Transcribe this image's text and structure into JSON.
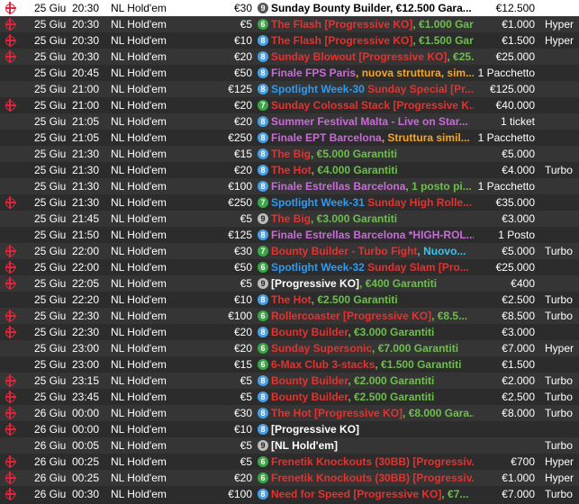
{
  "colors": {
    "red": "#e5322f",
    "green": "#6cc04a",
    "orange": "#f5a623",
    "pink": "#ff5a5a",
    "purple": "#c86bd8",
    "cyan": "#33c6ef",
    "blue": "#2f9bf0",
    "white": "#ffffff",
    "black": "#000000"
  },
  "rows": [
    {
      "icon": "target-icon",
      "date": "25 Giu",
      "time": "20:30",
      "game": "NL Hold'em",
      "buyin": "€30",
      "badge": "9",
      "badge_color": "dark",
      "name": [
        {
          "t": "Sunday Bounty Builder, €12.500 Gara...",
          "c": "black"
        }
      ],
      "prize": "€12.500",
      "speed": "",
      "selected": true
    },
    {
      "icon": "target-icon",
      "date": "25 Giu",
      "time": "20:30",
      "game": "NL Hold'em",
      "buyin": "€5",
      "badge": "6",
      "badge_color": "green",
      "name": [
        {
          "t": "The Flash [Progressive KO]",
          "c": "red"
        },
        {
          "t": ", €1.000 Garanti...",
          "c": "green"
        }
      ],
      "prize": "€1.000",
      "speed": "Hyper"
    },
    {
      "icon": "target-icon",
      "date": "25 Giu",
      "time": "20:30",
      "game": "NL Hold'em",
      "buyin": "€10",
      "badge": "8",
      "badge_color": "blue",
      "name": [
        {
          "t": "The Flash [Progressive KO]",
          "c": "red"
        },
        {
          "t": ", €1.500 Garanti...",
          "c": "green"
        }
      ],
      "prize": "€1.500",
      "speed": "Hyper"
    },
    {
      "icon": "target-icon",
      "date": "25 Giu",
      "time": "20:30",
      "game": "NL Hold'em",
      "buyin": "€20",
      "badge": "8",
      "badge_color": "blue",
      "name": [
        {
          "t": "Sunday Blowout [Progressive KO]",
          "c": "red"
        },
        {
          "t": ", €25.000...",
          "c": "green"
        }
      ],
      "prize": "€25.000",
      "speed": ""
    },
    {
      "icon": "",
      "date": "25 Giu",
      "time": "20:45",
      "game": "NL Hold'em",
      "buyin": "€50",
      "badge": "8",
      "badge_color": "blue",
      "name": [
        {
          "t": "Finale FPS Paris",
          "c": "purple"
        },
        {
          "t": ", nuova struttura, sim...",
          "c": "orange"
        }
      ],
      "prize": "1 Pacchetto",
      "speed": ""
    },
    {
      "icon": "",
      "date": "25 Giu",
      "time": "21:00",
      "game": "NL Hold'em",
      "buyin": "€125",
      "badge": "8",
      "badge_color": "blue",
      "name": [
        {
          "t": "Spotlight Week-30",
          "c": "blue"
        },
        {
          "t": " Sunday Special [Pr...",
          "c": "red"
        }
      ],
      "prize": "€125.000",
      "speed": ""
    },
    {
      "icon": "target-icon",
      "date": "25 Giu",
      "time": "21:00",
      "game": "NL Hold'em",
      "buyin": "€20",
      "badge": "7",
      "badge_color": "green",
      "name": [
        {
          "t": "Sunday Colossal Stack [Progressive K...",
          "c": "red"
        }
      ],
      "prize": "€40.000",
      "speed": ""
    },
    {
      "icon": "",
      "date": "25 Giu",
      "time": "21:05",
      "game": "NL Hold'em",
      "buyin": "€20",
      "badge": "8",
      "badge_color": "blue",
      "name": [
        {
          "t": "Summer Festival Malta - Live on Star...",
          "c": "purple"
        }
      ],
      "prize": "1 ticket",
      "speed": ""
    },
    {
      "icon": "",
      "date": "25 Giu",
      "time": "21:05",
      "game": "NL Hold'em",
      "buyin": "€250",
      "badge": "8",
      "badge_color": "blue",
      "name": [
        {
          "t": "Finale EPT Barcelona",
          "c": "purple"
        },
        {
          "t": ", Struttura simil...",
          "c": "orange"
        }
      ],
      "prize": "1 Pacchetto",
      "speed": ""
    },
    {
      "icon": "",
      "date": "25 Giu",
      "time": "21:30",
      "game": "NL Hold'em",
      "buyin": "€15",
      "badge": "8",
      "badge_color": "blue",
      "name": [
        {
          "t": "The Big",
          "c": "red"
        },
        {
          "t": ", €5.000 Garantiti",
          "c": "green"
        }
      ],
      "prize": "€5.000",
      "speed": ""
    },
    {
      "icon": "",
      "date": "25 Giu",
      "time": "21:30",
      "game": "NL Hold'em",
      "buyin": "€20",
      "badge": "8",
      "badge_color": "blue",
      "name": [
        {
          "t": "The Hot",
          "c": "red"
        },
        {
          "t": ", €4.000 Garantiti",
          "c": "green"
        }
      ],
      "prize": "€4.000",
      "speed": "Turbo"
    },
    {
      "icon": "",
      "date": "25 Giu",
      "time": "21:30",
      "game": "NL Hold'em",
      "buyin": "€100",
      "badge": "8",
      "badge_color": "blue",
      "name": [
        {
          "t": "Finale Estrellas Barcelona",
          "c": "purple"
        },
        {
          "t": ", 1 posto pi...",
          "c": "green"
        }
      ],
      "prize": "1 Pacchetto",
      "speed": ""
    },
    {
      "icon": "target-icon",
      "date": "25 Giu",
      "time": "21:30",
      "game": "NL Hold'em",
      "buyin": "€250",
      "badge": "7",
      "badge_color": "green",
      "name": [
        {
          "t": "Spotlight Week-31",
          "c": "blue"
        },
        {
          "t": " Sunday High Rolle...",
          "c": "red"
        }
      ],
      "prize": "€35.000",
      "speed": ""
    },
    {
      "icon": "",
      "date": "25 Giu",
      "time": "21:45",
      "game": "NL Hold'em",
      "buyin": "€5",
      "badge": "9",
      "badge_color": "gray",
      "name": [
        {
          "t": "The Big",
          "c": "red"
        },
        {
          "t": ", €3.000 Garantiti",
          "c": "green"
        }
      ],
      "prize": "€3.000",
      "speed": ""
    },
    {
      "icon": "",
      "date": "25 Giu",
      "time": "21:50",
      "game": "NL Hold'em",
      "buyin": "€125",
      "badge": "8",
      "badge_color": "blue",
      "name": [
        {
          "t": "Finale Estrellas Barcelona *HIGH-ROL...",
          "c": "purple"
        }
      ],
      "prize": "1 Posto",
      "speed": ""
    },
    {
      "icon": "target-icon",
      "date": "25 Giu",
      "time": "22:00",
      "game": "NL Hold'em",
      "buyin": "€30",
      "badge": "7",
      "badge_color": "green",
      "name": [
        {
          "t": "Bounty Builder - Turbo Fight",
          "c": "red"
        },
        {
          "t": ", Nuovo...",
          "c": "cyan"
        }
      ],
      "prize": "€5.000",
      "speed": "Turbo"
    },
    {
      "icon": "target-icon",
      "date": "25 Giu",
      "time": "22:00",
      "game": "NL Hold'em",
      "buyin": "€50",
      "badge": "6",
      "badge_color": "green",
      "name": [
        {
          "t": "Spotlight Week-32",
          "c": "blue"
        },
        {
          "t": " Sunday Slam [Pro...",
          "c": "red"
        }
      ],
      "prize": "€25.000",
      "speed": ""
    },
    {
      "icon": "target-icon",
      "date": "25 Giu",
      "time": "22:05",
      "game": "NL Hold'em",
      "buyin": "€5",
      "badge": "9",
      "badge_color": "gray",
      "name": [
        {
          "t": "[Progressive KO]",
          "c": "white"
        },
        {
          "t": ", €400 Garantiti",
          "c": "green"
        }
      ],
      "prize": "€400",
      "speed": ""
    },
    {
      "icon": "",
      "date": "25 Giu",
      "time": "22:20",
      "game": "NL Hold'em",
      "buyin": "€10",
      "badge": "8",
      "badge_color": "blue",
      "name": [
        {
          "t": "The Hot",
          "c": "red"
        },
        {
          "t": ", €2.500 Garantiti",
          "c": "green"
        }
      ],
      "prize": "€2.500",
      "speed": "Turbo"
    },
    {
      "icon": "target-icon",
      "date": "25 Giu",
      "time": "22:30",
      "game": "NL Hold'em",
      "buyin": "€100",
      "badge": "6",
      "badge_color": "green",
      "name": [
        {
          "t": "Rollercoaster [Progressive KO]",
          "c": "red"
        },
        {
          "t": ", €8.5...",
          "c": "green"
        }
      ],
      "prize": "€8.500",
      "speed": "Turbo"
    },
    {
      "icon": "target-icon",
      "date": "25 Giu",
      "time": "22:30",
      "game": "NL Hold'em",
      "buyin": "€20",
      "badge": "8",
      "badge_color": "blue",
      "name": [
        {
          "t": "Bounty Builder",
          "c": "red"
        },
        {
          "t": ", €3.000 Garantiti",
          "c": "green"
        }
      ],
      "prize": "€3.000",
      "speed": ""
    },
    {
      "icon": "",
      "date": "25 Giu",
      "time": "23:00",
      "game": "NL Hold'em",
      "buyin": "€20",
      "badge": "6",
      "badge_color": "green",
      "name": [
        {
          "t": "Sunday Supersonic",
          "c": "red"
        },
        {
          "t": ", €7.000 Garantiti",
          "c": "green"
        }
      ],
      "prize": "€7.000",
      "speed": "Hyper"
    },
    {
      "icon": "",
      "date": "25 Giu",
      "time": "23:00",
      "game": "NL Hold'em",
      "buyin": "€15",
      "badge": "6",
      "badge_color": "green",
      "name": [
        {
          "t": "6-Max Club 3-stacks",
          "c": "red"
        },
        {
          "t": ", €1.500 Garantiti",
          "c": "green"
        }
      ],
      "prize": "€1.500",
      "speed": ""
    },
    {
      "icon": "target-icon",
      "date": "25 Giu",
      "time": "23:15",
      "game": "NL Hold'em",
      "buyin": "€5",
      "badge": "8",
      "badge_color": "blue",
      "name": [
        {
          "t": "Bounty Builder",
          "c": "red"
        },
        {
          "t": ", €2.000 Garantiti",
          "c": "green"
        }
      ],
      "prize": "€2.000",
      "speed": "Turbo"
    },
    {
      "icon": "target-icon",
      "date": "25 Giu",
      "time": "23:45",
      "game": "NL Hold'em",
      "buyin": "€5",
      "badge": "8",
      "badge_color": "blue",
      "name": [
        {
          "t": "Bounty Builder",
          "c": "red"
        },
        {
          "t": ", €2.500 Garantiti",
          "c": "green"
        }
      ],
      "prize": "€2.500",
      "speed": "Turbo"
    },
    {
      "icon": "target-icon",
      "date": "26 Giu",
      "time": "00:00",
      "game": "NL Hold'em",
      "buyin": "€30",
      "badge": "8",
      "badge_color": "blue",
      "name": [
        {
          "t": "The Hot [Progressive KO]",
          "c": "red"
        },
        {
          "t": ", €8.000 Gara...",
          "c": "green"
        }
      ],
      "prize": "€8.000",
      "speed": "Turbo"
    },
    {
      "icon": "target-icon",
      "date": "26 Giu",
      "time": "00:00",
      "game": "NL Hold'em",
      "buyin": "€10",
      "badge": "8",
      "badge_color": "blue",
      "name": [
        {
          "t": "[Progressive KO]",
          "c": "white"
        }
      ],
      "prize": "",
      "speed": ""
    },
    {
      "icon": "",
      "date": "26 Giu",
      "time": "00:05",
      "game": "NL Hold'em",
      "buyin": "€5",
      "badge": "9",
      "badge_color": "gray",
      "name": [
        {
          "t": "[NL Hold'em]",
          "c": "white"
        }
      ],
      "prize": "",
      "speed": "Turbo"
    },
    {
      "icon": "target-icon",
      "date": "26 Giu",
      "time": "00:25",
      "game": "NL Hold'em",
      "buyin": "€5",
      "badge": "6",
      "badge_color": "green",
      "name": [
        {
          "t": "Frenetik Knockouts (30BB) [Progressiv...",
          "c": "red"
        }
      ],
      "prize": "€700",
      "speed": "Hyper"
    },
    {
      "icon": "target-icon",
      "date": "26 Giu",
      "time": "00:25",
      "game": "NL Hold'em",
      "buyin": "€20",
      "badge": "6",
      "badge_color": "green",
      "name": [
        {
          "t": "Frenetik Knockouts (30BB) [Progressiv...",
          "c": "red"
        }
      ],
      "prize": "€1.000",
      "speed": "Hyper"
    },
    {
      "icon": "target-icon",
      "date": "26 Giu",
      "time": "00:30",
      "game": "NL Hold'em",
      "buyin": "€100",
      "badge": "8",
      "badge_color": "blue",
      "name": [
        {
          "t": "Need for Speed [Progressive KO]",
          "c": "red"
        },
        {
          "t": ", €7...",
          "c": "green"
        }
      ],
      "prize": "€7.000",
      "speed": "Turbo"
    }
  ]
}
